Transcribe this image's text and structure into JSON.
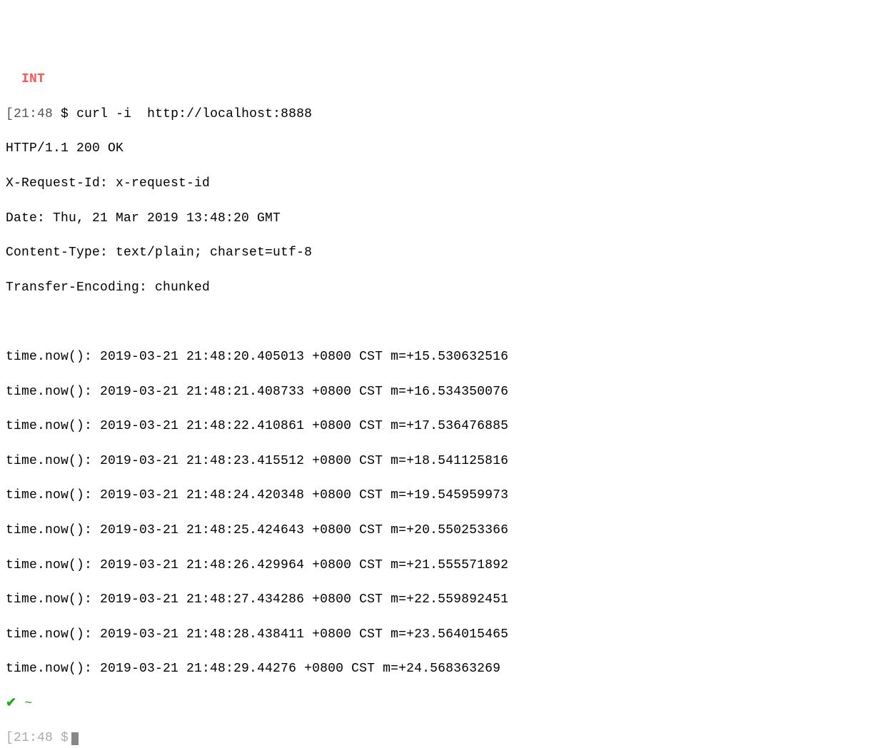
{
  "top_marker": "INT",
  "prompt": {
    "time": "21:48",
    "symbol": "$",
    "command": "curl -i  http://localhost:8888"
  },
  "response": {
    "status_line": "HTTP/1.1 200 OK",
    "headers": [
      "X-Request-Id: x-request-id",
      "Date: Thu, 21 Mar 2019 13:48:20 GMT",
      "Content-Type: text/plain; charset=utf-8",
      "Transfer-Encoding: chunked"
    ],
    "body_lines": [
      "time.now(): 2019-03-21 21:48:20.405013 +0800 CST m=+15.530632516",
      "time.now(): 2019-03-21 21:48:21.408733 +0800 CST m=+16.534350076",
      "time.now(): 2019-03-21 21:48:22.410861 +0800 CST m=+17.536476885",
      "time.now(): 2019-03-21 21:48:23.415512 +0800 CST m=+18.541125816",
      "time.now(): 2019-03-21 21:48:24.420348 +0800 CST m=+19.545959973",
      "time.now(): 2019-03-21 21:48:25.424643 +0800 CST m=+20.550253366",
      "time.now(): 2019-03-21 21:48:26.429964 +0800 CST m=+21.555571892",
      "time.now(): 2019-03-21 21:48:27.434286 +0800 CST m=+22.559892451",
      "time.now(): 2019-03-21 21:48:28.438411 +0800 CST m=+23.564015465",
      "time.now(): 2019-03-21 21:48:29.44276 +0800 CST m=+24.568363269"
    ]
  },
  "footer": {
    "check": "✔",
    "tilde": "~",
    "next_time": "21:48",
    "next_symbol": "$"
  }
}
